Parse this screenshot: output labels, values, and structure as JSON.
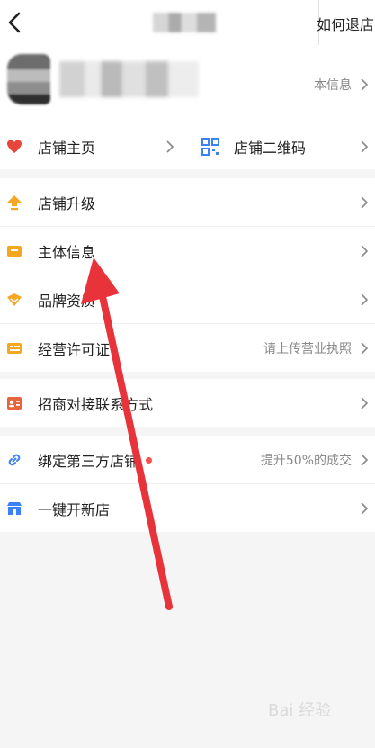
{
  "header": {
    "help_label": "如何退店"
  },
  "profile": {
    "basic_info_label": "本信息"
  },
  "shop_row": {
    "left_label": "店铺主页",
    "right_label": "店铺二维码"
  },
  "section1": {
    "items": [
      {
        "label": "店铺升级",
        "value": ""
      },
      {
        "label": "主体信息",
        "value": ""
      },
      {
        "label": "品牌资质",
        "value": ""
      },
      {
        "label": "经营许可证",
        "value": "请上传营业执照"
      }
    ]
  },
  "section2": {
    "items": [
      {
        "label": "招商对接联系方式",
        "value": ""
      }
    ]
  },
  "section3": {
    "items": [
      {
        "label": "绑定第三方店铺",
        "value": "提升50%的成交"
      },
      {
        "label": "一键开新店",
        "value": ""
      }
    ]
  },
  "watermark": "Bai 经验",
  "colors": {
    "accent_red": "#e8333b",
    "shop_red": "#e8453c",
    "icon_orange": "#f5a623",
    "icon_blue": "#3b82f6"
  }
}
